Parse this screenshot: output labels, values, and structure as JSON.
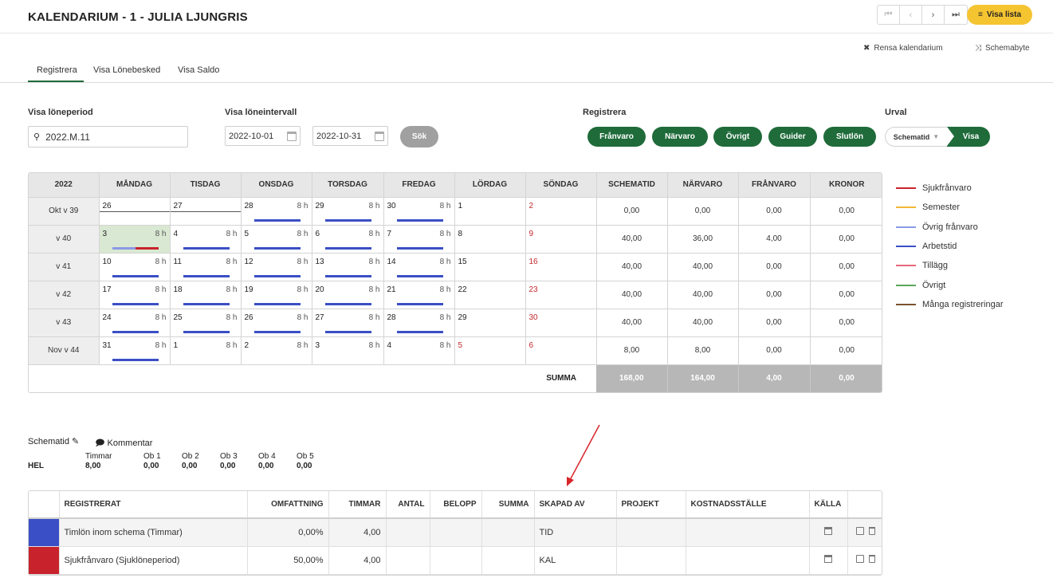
{
  "header": {
    "title": "KALENDARIUM - 1 - JULIA LJUNGRIS",
    "nav": {
      "first": "⏮",
      "prev": "‹",
      "next": "›",
      "last": "⏭"
    },
    "visa_lista": "Visa lista",
    "rensa": "Rensa kalendarium",
    "schemabyte": "Schemabyte"
  },
  "tabs": [
    {
      "label": "Registrera",
      "active": true
    },
    {
      "label": "Visa Lönebesked",
      "active": false
    },
    {
      "label": "Visa Saldo",
      "active": false
    }
  ],
  "filters": {
    "period_label": "Visa löneperiod",
    "period_value": "2022.M.11",
    "interval_label": "Visa löneintervall",
    "date_from": "2022-10-01",
    "date_to": "2022-10-31",
    "sok": "Sök",
    "registrera_label": "Registrera",
    "reg_buttons": [
      "Frånvaro",
      "Närvaro",
      "Övrigt",
      "Guider",
      "Slutlön"
    ],
    "urval_label": "Urval",
    "urval_value": "Schematid",
    "urval_visa": "Visa"
  },
  "calendar": {
    "headers": [
      "2022",
      "MÅNDAG",
      "TISDAG",
      "ONSDAG",
      "TORSDAG",
      "FREDAG",
      "LÖRDAG",
      "SÖNDAG",
      "SCHEMATID",
      "NÄRVARO",
      "FRÅNVARO",
      "KRONOR"
    ],
    "hours_label": "8 h",
    "weeks": [
      {
        "label": "Okt v 39",
        "days": [
          "26",
          "27",
          "28",
          "29",
          "30",
          "1",
          "2"
        ],
        "totals": [
          "0,00",
          "0,00",
          "0,00",
          "0,00"
        ]
      },
      {
        "label": "v 40",
        "days": [
          "3",
          "4",
          "5",
          "6",
          "7",
          "8",
          "9"
        ],
        "totals": [
          "40,00",
          "36,00",
          "4,00",
          "0,00"
        ]
      },
      {
        "label": "v 41",
        "days": [
          "10",
          "11",
          "12",
          "13",
          "14",
          "15",
          "16"
        ],
        "totals": [
          "40,00",
          "40,00",
          "0,00",
          "0,00"
        ]
      },
      {
        "label": "v 42",
        "days": [
          "17",
          "18",
          "19",
          "20",
          "21",
          "22",
          "23"
        ],
        "totals": [
          "40,00",
          "40,00",
          "0,00",
          "0,00"
        ]
      },
      {
        "label": "v 43",
        "days": [
          "24",
          "25",
          "26",
          "27",
          "28",
          "29",
          "30"
        ],
        "totals": [
          "40,00",
          "40,00",
          "0,00",
          "0,00"
        ]
      },
      {
        "label": "Nov v 44",
        "days": [
          "31",
          "1",
          "2",
          "3",
          "4",
          "5",
          "6"
        ],
        "totals": [
          "8,00",
          "8,00",
          "0,00",
          "0,00"
        ]
      }
    ],
    "summa_label": "SUMMA",
    "summa": [
      "168,00",
      "164,00",
      "4,00",
      "0,00"
    ]
  },
  "legend": [
    {
      "label": "Sjukfrånvaro",
      "color": "#c8232c"
    },
    {
      "label": "Semester",
      "color": "#f2b636"
    },
    {
      "label": "Övrig frånvaro",
      "color": "#8a9ae6"
    },
    {
      "label": "Arbetstid",
      "color": "#3a4fc5"
    },
    {
      "label": "Tillägg",
      "color": "#e8677a"
    },
    {
      "label": "Övrigt",
      "color": "#5aa75a"
    },
    {
      "label": "Många registreringar",
      "color": "#7a5230"
    }
  ],
  "schematid": {
    "label": "Schematid",
    "kommentar": "Kommentar",
    "row_label": "HEL",
    "cols": [
      {
        "head": "Timmar",
        "val": "8,00"
      },
      {
        "head": "Ob 1",
        "val": "0,00"
      },
      {
        "head": "Ob 2",
        "val": "0,00"
      },
      {
        "head": "Ob 3",
        "val": "0,00"
      },
      {
        "head": "Ob 4",
        "val": "0,00"
      },
      {
        "head": "Ob 5",
        "val": "0,00"
      }
    ]
  },
  "registrations": {
    "headers": [
      "REGISTRERAT",
      "OMFATTNING",
      "TIMMAR",
      "ANTAL",
      "BELOPP",
      "SUMMA",
      "SKAPAD AV",
      "PROJEKT",
      "KOSTNADSSTÄLLE",
      "KÄLLA"
    ],
    "rows": [
      {
        "color": "#3a4fc5",
        "name": "Timlön inom schema (Timmar)",
        "omf": "0,00%",
        "timmar": "4,00",
        "skapad": "TID"
      },
      {
        "color": "#c8232c",
        "name": "Sjukfrånvaro (Sjuklöneperiod)",
        "omf": "50,00%",
        "timmar": "4,00",
        "skapad": "KAL"
      }
    ]
  }
}
